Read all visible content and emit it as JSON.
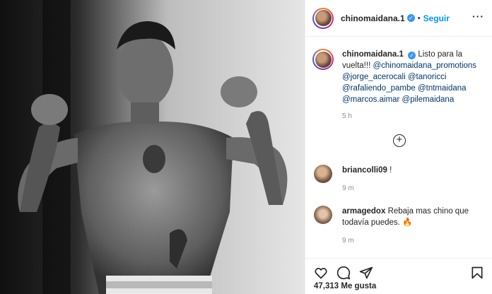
{
  "header": {
    "username": "chinomaidana.1",
    "separator": "•",
    "follow_label": "Seguir",
    "more_icon": "more-horizontal-icon"
  },
  "caption": {
    "username": "chinomaidana.1",
    "text": "Listo para la vuelta!!!",
    "mentions": [
      "@chinomaidana_promotions",
      "@jorge_acerocali",
      "@tanoricci",
      "@rafaliendo_pambe",
      "@tntmaidana",
      "@marcos.aimar",
      "@pilemaidana"
    ],
    "time": "5 h"
  },
  "load_more_icon": "plus-circle-icon",
  "comments": [
    {
      "username": "briancolli09",
      "text": "!",
      "time": "9 m"
    },
    {
      "username": "armagedox",
      "text": "Rebaja mas chino que todavía puedes. 🔥",
      "time": "9 m"
    }
  ],
  "actions": {
    "like_icon": "heart-icon",
    "comment_icon": "comment-icon",
    "share_icon": "send-icon",
    "save_icon": "bookmark-icon"
  },
  "likes": "47,313 Me gusta",
  "colors": {
    "link": "#0095f6",
    "mention": "#00376b",
    "verified": "#3897f0",
    "muted": "#8e8e8e",
    "border": "#efefef"
  }
}
